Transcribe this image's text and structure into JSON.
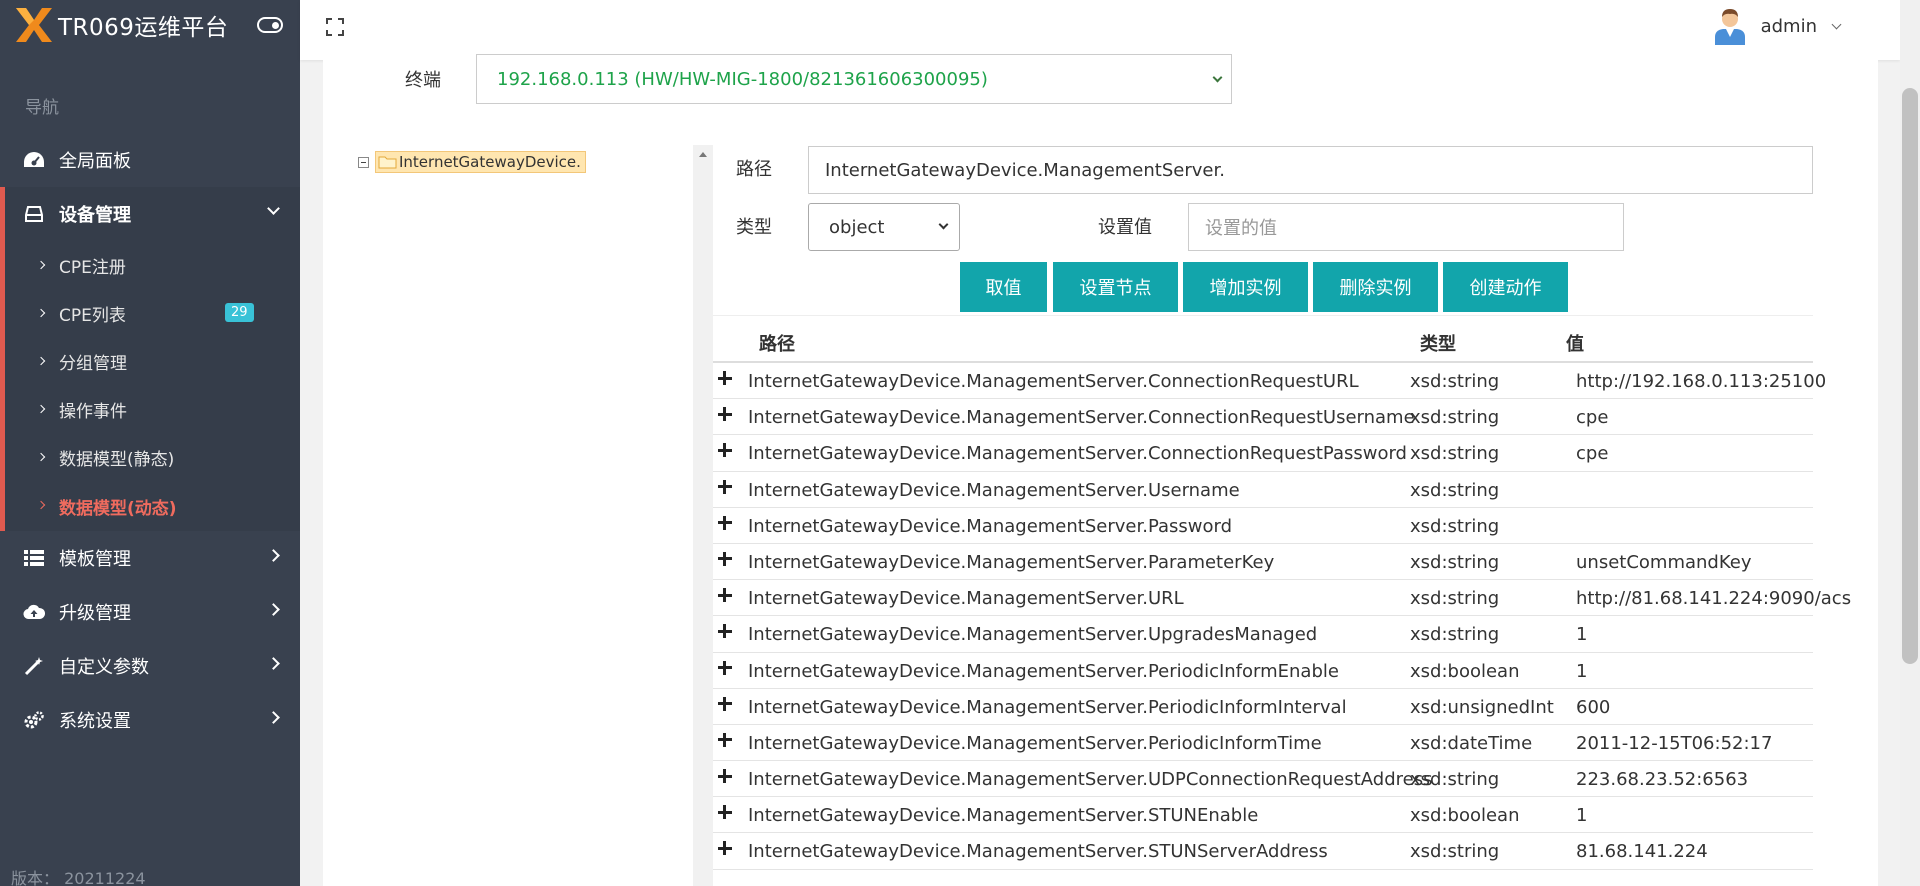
{
  "app": {
    "title": "TR069运维平台",
    "version_label": "版本：",
    "version": "20211224"
  },
  "nav": {
    "header": "导航",
    "dashboard": "全局面板",
    "device_mgmt": "设备管理",
    "device_sub": [
      {
        "label": "CPE注册"
      },
      {
        "label": "CPE列表",
        "badge": "29"
      },
      {
        "label": "分组管理"
      },
      {
        "label": "操作事件"
      },
      {
        "label": "数据模型(静态)"
      },
      {
        "label": "数据模型(动态)"
      }
    ],
    "template_mgmt": "模板管理",
    "upgrade_mgmt": "升级管理",
    "custom_params": "自定义参数",
    "system_settings": "系统设置"
  },
  "topbar": {
    "username": "admin"
  },
  "terminal": {
    "label": "终端",
    "value": "192.168.0.113 (HW/HW-MIG-1800/821361606300095)"
  },
  "tree": {
    "root": "InternetGatewayDevice."
  },
  "form": {
    "path_label": "路径",
    "path_value": "InternetGatewayDevice.ManagementServer.",
    "type_label": "类型",
    "type_value": "object",
    "setvalue_label": "设置值",
    "setvalue_placeholder": "设置的值"
  },
  "buttons": {
    "get": "取值",
    "set": "设置节点",
    "add": "增加实例",
    "delete": "删除实例",
    "create": "创建动作"
  },
  "table": {
    "headers": {
      "path": "路径",
      "type": "类型",
      "value": "值"
    },
    "rows": [
      {
        "path": "InternetGatewayDevice.ManagementServer.ConnectionRequestURL",
        "type": "xsd:string",
        "value": "http://192.168.0.113:25100"
      },
      {
        "path": "InternetGatewayDevice.ManagementServer.ConnectionRequestUsername",
        "type": "xsd:string",
        "value": "cpe"
      },
      {
        "path": "InternetGatewayDevice.ManagementServer.ConnectionRequestPassword",
        "type": "xsd:string",
        "value": "cpe"
      },
      {
        "path": "InternetGatewayDevice.ManagementServer.Username",
        "type": "xsd:string",
        "value": ""
      },
      {
        "path": "InternetGatewayDevice.ManagementServer.Password",
        "type": "xsd:string",
        "value": ""
      },
      {
        "path": "InternetGatewayDevice.ManagementServer.ParameterKey",
        "type": "xsd:string",
        "value": "unsetCommandKey"
      },
      {
        "path": "InternetGatewayDevice.ManagementServer.URL",
        "type": "xsd:string",
        "value": "http://81.68.141.224:9090/acs"
      },
      {
        "path": "InternetGatewayDevice.ManagementServer.UpgradesManaged",
        "type": "xsd:string",
        "value": "1"
      },
      {
        "path": "InternetGatewayDevice.ManagementServer.PeriodicInformEnable",
        "type": "xsd:boolean",
        "value": "1"
      },
      {
        "path": "InternetGatewayDevice.ManagementServer.PeriodicInformInterval",
        "type": "xsd:unsignedInt",
        "value": "600"
      },
      {
        "path": "InternetGatewayDevice.ManagementServer.PeriodicInformTime",
        "type": "xsd:dateTime",
        "value": "2011-12-15T06:52:17"
      },
      {
        "path": "InternetGatewayDevice.ManagementServer.UDPConnectionRequestAddress",
        "type": "xsd:string",
        "value": "223.68.23.52:6563"
      },
      {
        "path": "InternetGatewayDevice.ManagementServer.STUNEnable",
        "type": "xsd:boolean",
        "value": "1"
      },
      {
        "path": "InternetGatewayDevice.ManagementServer.STUNServerAddress",
        "type": "xsd:string",
        "value": "81.68.141.224"
      }
    ]
  },
  "colors": {
    "sidebar_bg": "#39414f",
    "accent": "#12a5ab",
    "active_nav": "#ef6b5e",
    "badge": "#39c2d7",
    "terminal_text": "#1ea34a"
  }
}
